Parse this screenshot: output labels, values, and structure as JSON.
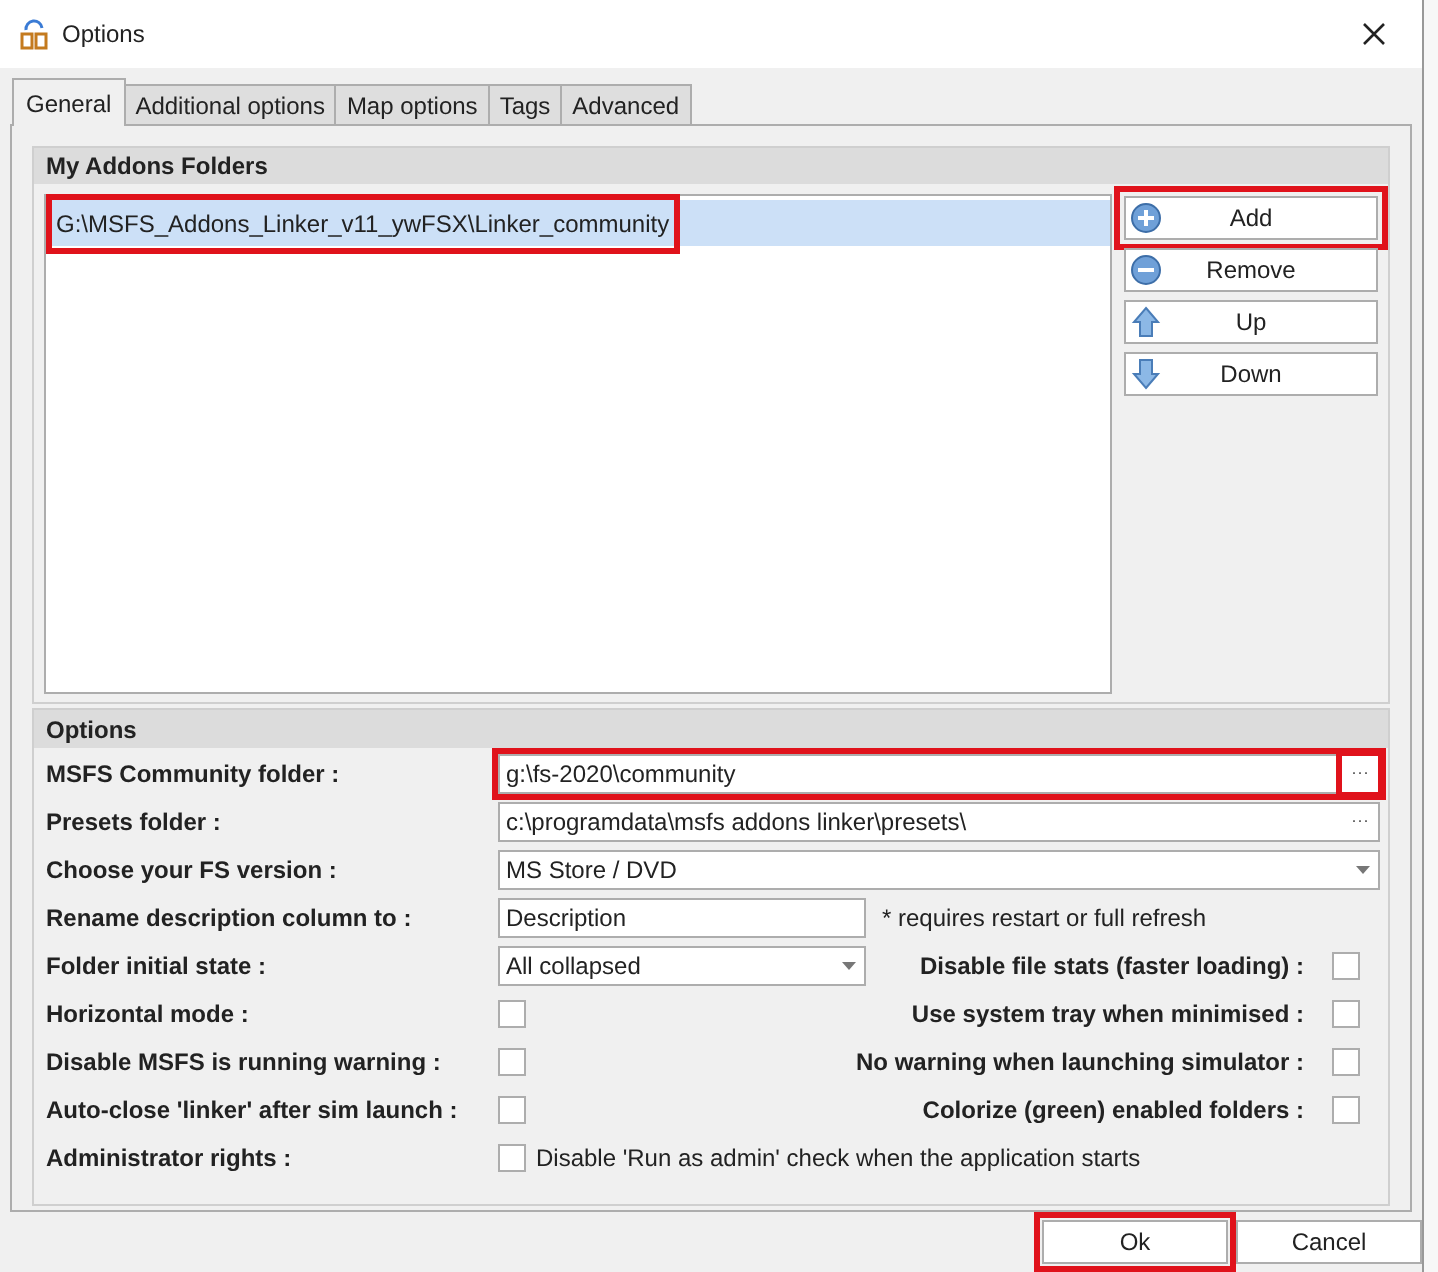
{
  "window": {
    "title": "Options"
  },
  "tabs": [
    {
      "label": "General",
      "selected": true
    },
    {
      "label": "Additional options",
      "selected": false
    },
    {
      "label": "Map options",
      "selected": false
    },
    {
      "label": "Tags",
      "selected": false
    },
    {
      "label": "Advanced",
      "selected": false
    }
  ],
  "addons_folders": {
    "title": "My Addons Folders",
    "items": [
      {
        "path": "G:\\MSFS_Addons_Linker_v11_ywFSX\\Linker_community",
        "selected": true,
        "highlighted": true
      }
    ],
    "buttons": [
      {
        "label": "Add",
        "kind": "add",
        "highlighted": true
      },
      {
        "label": "Remove",
        "kind": "remove",
        "highlighted": false
      },
      {
        "label": "Up",
        "kind": "up",
        "highlighted": false
      },
      {
        "label": "Down",
        "kind": "down",
        "highlighted": false
      }
    ]
  },
  "options": {
    "title": "Options",
    "rows": [
      {
        "label": "MSFS Community folder :",
        "kind": "browse",
        "value": "g:\\fs-2020\\community",
        "browse": "···",
        "highlighted": true,
        "browse_highlighted": true
      },
      {
        "label": "Presets folder :",
        "kind": "browse",
        "value": "c:\\programdata\\msfs addons linker\\presets\\",
        "browse": "···",
        "highlighted": false,
        "browse_highlighted": false
      },
      {
        "label": "Choose your FS version :",
        "kind": "dropdown",
        "value": "MS Store / DVD",
        "wide": true
      },
      {
        "label": "Rename description column to :",
        "kind": "text",
        "value": "Description",
        "note": "* requires restart or full refresh"
      },
      {
        "label": "Folder initial state :",
        "kind": "dropdown",
        "value": "All collapsed",
        "wide": false,
        "right": {
          "label": "Disable file stats (faster loading) :",
          "checked": false
        }
      },
      {
        "label": "Horizontal mode :",
        "kind": "checkbox",
        "checked": false,
        "right": {
          "label": "Use system tray when minimised :",
          "checked": false
        }
      },
      {
        "label": "Disable MSFS is running warning :",
        "kind": "checkbox",
        "checked": false,
        "right": {
          "label": "No warning when launching simulator :",
          "checked": false
        }
      },
      {
        "label": "Auto-close 'linker' after sim launch :",
        "kind": "checkbox",
        "checked": false,
        "right": {
          "label": "Colorize (green) enabled folders :",
          "checked": false
        }
      },
      {
        "label": "Administrator rights :",
        "kind": "checkbox",
        "checked": false,
        "text": "Disable 'Run as admin' check when the application starts"
      }
    ]
  },
  "footer": {
    "buttons": [
      {
        "label": "Ok",
        "highlighted": true
      },
      {
        "label": "Cancel",
        "highlighted": false
      }
    ]
  }
}
